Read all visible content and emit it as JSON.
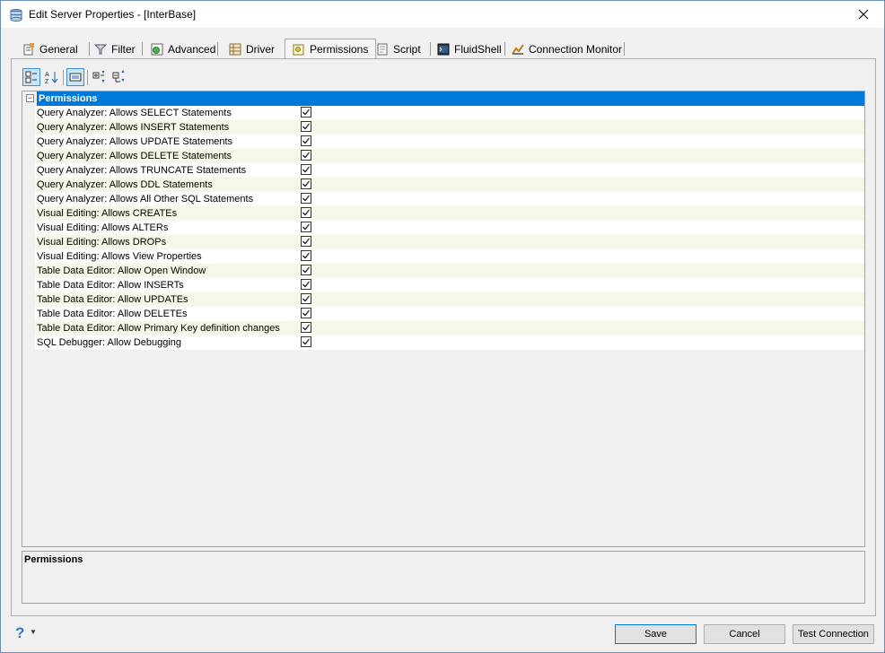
{
  "window": {
    "title": "Edit Server Properties - [InterBase]"
  },
  "tabs": [
    {
      "label": "General",
      "icon": "general-icon"
    },
    {
      "label": "Filter",
      "icon": "filter-icon"
    },
    {
      "label": "Advanced",
      "icon": "advanced-icon"
    },
    {
      "label": "Driver",
      "icon": "driver-icon"
    },
    {
      "label": "Permissions",
      "icon": "permissions-icon",
      "active": true
    },
    {
      "label": "Script",
      "icon": "script-icon"
    },
    {
      "label": "FluidShell",
      "icon": "fluidshell-icon"
    },
    {
      "label": "Connection Monitor",
      "icon": "connection-monitor-icon"
    }
  ],
  "toolbar": {
    "buttons": [
      "categorized-icon",
      "alphabetical-icon",
      "property-pages-icon",
      "expand-all-icon",
      "collapse-all-icon"
    ]
  },
  "grid": {
    "category": "Permissions",
    "rows": [
      {
        "label": "Query Analyzer: Allows SELECT Statements",
        "checked": true
      },
      {
        "label": "Query Analyzer: Allows INSERT Statements",
        "checked": true
      },
      {
        "label": "Query Analyzer: Allows UPDATE Statements",
        "checked": true
      },
      {
        "label": "Query Analyzer: Allows DELETE Statements",
        "checked": true
      },
      {
        "label": "Query Analyzer: Allows TRUNCATE Statements",
        "checked": true
      },
      {
        "label": "Query Analyzer: Allows DDL Statements",
        "checked": true
      },
      {
        "label": "Query Analyzer: Allows All Other SQL Statements",
        "checked": true
      },
      {
        "label": "Visual Editing: Allows CREATEs",
        "checked": true
      },
      {
        "label": "Visual Editing: Allows ALTERs",
        "checked": true
      },
      {
        "label": "Visual Editing: Allows DROPs",
        "checked": true
      },
      {
        "label": "Visual Editing: Allows View Properties",
        "checked": true
      },
      {
        "label": "Table Data Editor: Allow Open Window",
        "checked": true
      },
      {
        "label": "Table Data Editor: Allow INSERTs",
        "checked": true
      },
      {
        "label": "Table Data Editor: Allow UPDATEs",
        "checked": true
      },
      {
        "label": "Table Data Editor: Allow DELETEs",
        "checked": true
      },
      {
        "label": "Table Data Editor: Allow Primary Key definition changes",
        "checked": true
      },
      {
        "label": "SQL Debugger: Allow Debugging",
        "checked": true
      }
    ]
  },
  "description": {
    "title": "Permissions"
  },
  "footer": {
    "help": "?",
    "save": "Save",
    "cancel": "Cancel",
    "test": "Test Connection"
  }
}
